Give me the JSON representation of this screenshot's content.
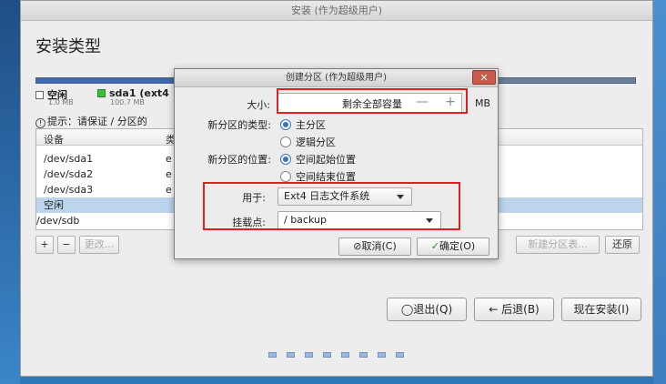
{
  "window": {
    "title": "安装 (作为超级用户)"
  },
  "page_title": "安装类型",
  "legend": [
    {
      "label": "空闲",
      "size": "1.0 MB",
      "color": "#ffffff"
    },
    {
      "label": "sda1 (ext4",
      "size": "100.7 MB",
      "color": "#3dbd3d"
    }
  ],
  "hint": "提示：请保证 / 分区的",
  "table": {
    "headers": [
      "设备",
      "类"
    ],
    "rows": [
      {
        "device": "/dev/sda1",
        "type": "e"
      },
      {
        "device": "/dev/sda2",
        "type": "e"
      },
      {
        "device": "/dev/sda3",
        "type": "e"
      },
      {
        "device": "空闲",
        "type": ""
      },
      {
        "device": "/dev/sdb",
        "type": ""
      }
    ]
  },
  "table_buttons": {
    "add": "+",
    "remove": "−",
    "change": "更改...",
    "new_table": "新建分区表...",
    "revert": "还原"
  },
  "nav": {
    "quit": "退出(Q)",
    "back": "← 后退(B)",
    "install": "现在安装(I)"
  },
  "dialog": {
    "title": "创建分区 (作为超级用户)",
    "close": "✕",
    "size_label": "大小:",
    "size_value": "剩余全部容量",
    "minus": "—",
    "plus": "+",
    "unit": "MB",
    "type_label": "新分区的类型:",
    "type_options": [
      "主分区",
      "逻辑分区"
    ],
    "location_label": "新分区的位置:",
    "location_options": [
      "空间起始位置",
      "空间结束位置"
    ],
    "use_label": "用于:",
    "use_value": "Ext4 日志文件系统",
    "mount_label": "挂载点:",
    "mount_value": "/ backup",
    "cancel": "取消(C)",
    "ok": "确定(O)"
  },
  "colors": {
    "highlight": "#e02020",
    "accent": "#3a73bd"
  }
}
